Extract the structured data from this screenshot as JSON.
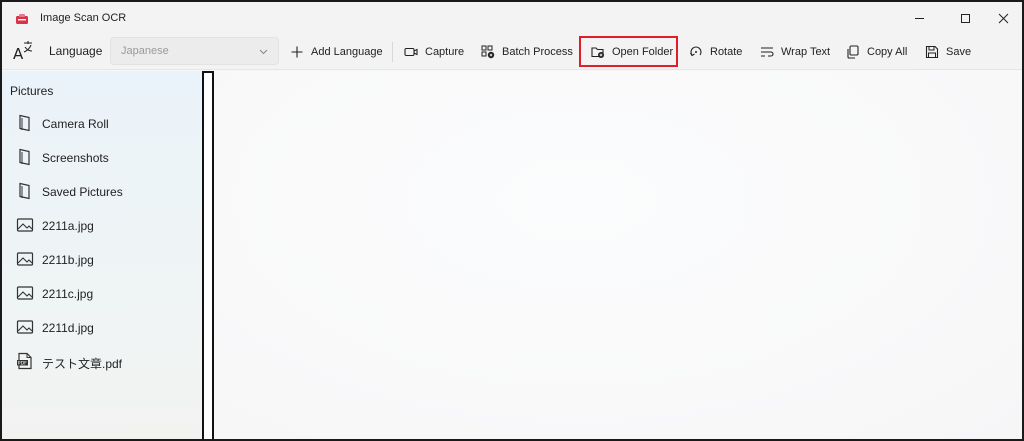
{
  "window": {
    "title": "Image Scan OCR",
    "controls": [
      "minimize",
      "maximize",
      "close"
    ]
  },
  "toolbar": {
    "language_label": "Language",
    "language_value": "Japanese",
    "add_language": "Add Language",
    "capture": "Capture",
    "batch_process": "Batch Process",
    "open_folder": "Open Folder",
    "rotate": "Rotate",
    "wrap_text": "Wrap Text",
    "copy_all": "Copy All",
    "save": "Save"
  },
  "sidebar": {
    "header": "Pictures",
    "items": [
      {
        "label": "Camera Roll",
        "icon": "folder-bookmark-icon"
      },
      {
        "label": "Screenshots",
        "icon": "folder-bookmark-icon"
      },
      {
        "label": "Saved Pictures",
        "icon": "folder-bookmark-icon"
      },
      {
        "label": "2211a.jpg",
        "icon": "image-icon"
      },
      {
        "label": "2211b.jpg",
        "icon": "image-icon"
      },
      {
        "label": "2211c.jpg",
        "icon": "image-icon"
      },
      {
        "label": "2211d.jpg",
        "icon": "image-icon"
      },
      {
        "label": "テスト文章.pdf",
        "icon": "pdf-icon"
      }
    ]
  },
  "colors": {
    "highlight": "#e01e2a",
    "app_icon": "#d9334a"
  }
}
